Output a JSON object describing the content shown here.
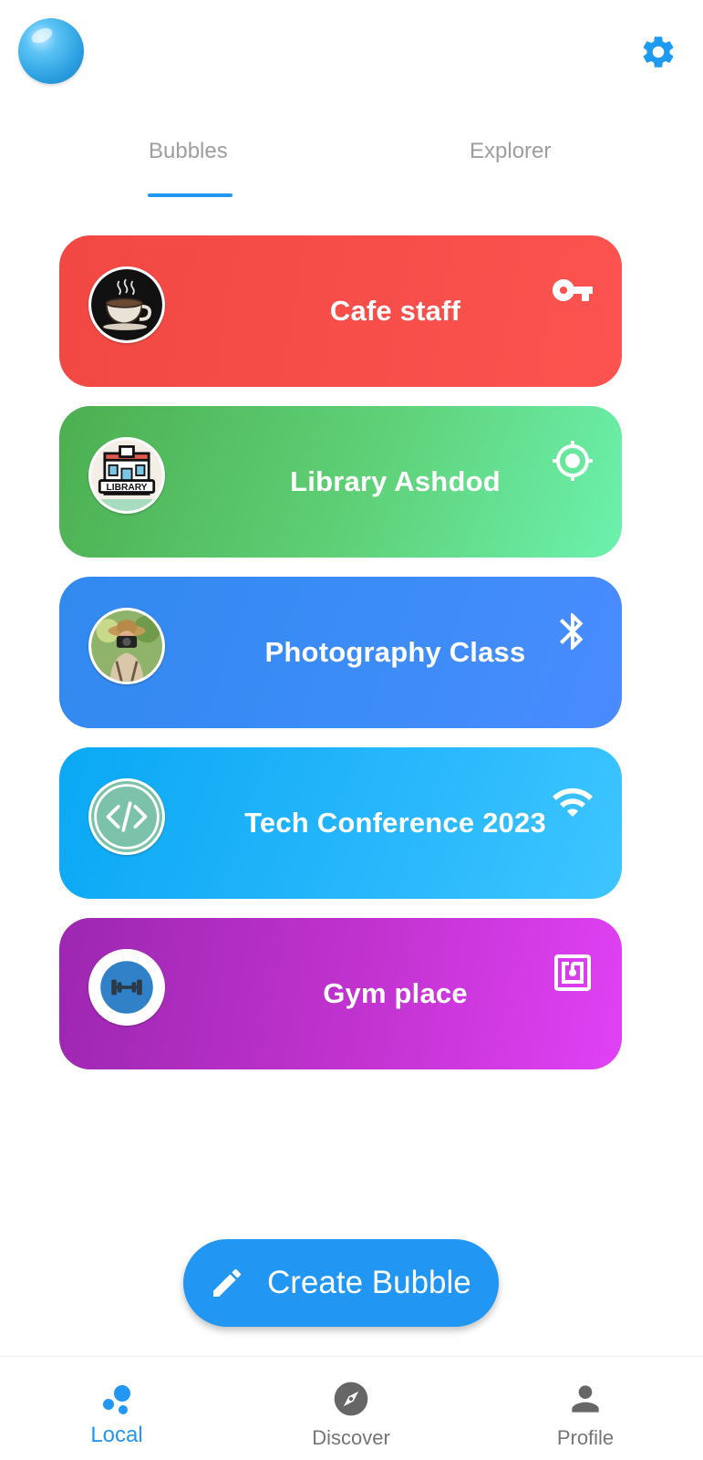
{
  "header": {
    "logo_icon": "bubble-logo-icon",
    "settings_icon": "gear-icon"
  },
  "tabs": [
    {
      "label": "Bubbles",
      "active": true
    },
    {
      "label": "Explorer",
      "active": false
    }
  ],
  "accent_color": "#2196f3",
  "bubbles": [
    {
      "title": "Cafe staff",
      "avatar": "coffee-cup-avatar",
      "access_icon": "key-icon",
      "color": "#f44b46"
    },
    {
      "title": "Library Ashdod",
      "avatar": "library-building-avatar",
      "avatar_text": "LIBRARY",
      "access_icon": "location-target-icon",
      "color": "#5cc96f"
    },
    {
      "title": "Photography Class",
      "avatar": "photographer-avatar",
      "access_icon": "bluetooth-icon",
      "color": "#3d8cf5"
    },
    {
      "title": "Tech Conference 2023",
      "avatar": "code-brackets-avatar",
      "access_icon": "wifi-icon",
      "color": "#1fb1f8"
    },
    {
      "title": "Gym place",
      "avatar": "dumbbell-avatar",
      "access_icon": "nfc-icon",
      "color": "#c234d2"
    }
  ],
  "create_button": {
    "label": "Create Bubble",
    "icon": "pencil-icon"
  },
  "bottom_nav": [
    {
      "label": "Local",
      "icon": "bubbles-icon",
      "active": true
    },
    {
      "label": "Discover",
      "icon": "compass-icon",
      "active": false
    },
    {
      "label": "Profile",
      "icon": "person-icon",
      "active": false
    }
  ]
}
